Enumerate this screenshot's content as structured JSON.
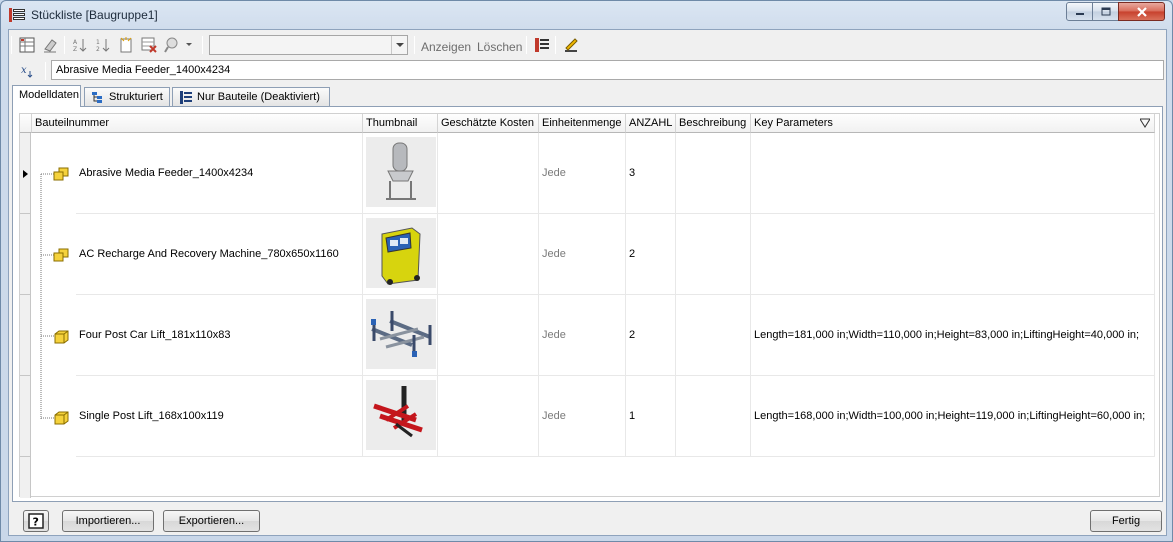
{
  "window": {
    "title": "Stückliste [Baugruppe1]"
  },
  "toolbar": {
    "combo_value": "",
    "show_label": "Anzeigen",
    "delete_label": "Löschen"
  },
  "formula": {
    "value": "Abrasive Media Feeder_1400x4234"
  },
  "tabs": [
    {
      "label": "Modelldaten"
    },
    {
      "label": "Strukturiert"
    },
    {
      "label": "Nur Bauteile (Deaktiviert)"
    }
  ],
  "table": {
    "columns": [
      "Bauteilnummer",
      "Thumbnail",
      "Geschätzte Kosten",
      "Einheitenmenge",
      "ANZAHL",
      "Beschreibung",
      "Key Parameters"
    ],
    "rows": [
      {
        "part": "Abrasive Media Feeder_1400x4234",
        "thumbnail": "media-feeder-thumbnail",
        "cost": "",
        "unit": "Jede",
        "qty": "3",
        "desc": "",
        "params": ""
      },
      {
        "part": "AC Recharge And Recovery Machine_780x650x1160",
        "thumbnail": "ac-machine-thumbnail",
        "cost": "",
        "unit": "Jede",
        "qty": "2",
        "desc": "",
        "params": ""
      },
      {
        "part": "Four Post Car Lift_181x110x83",
        "thumbnail": "four-post-lift-thumbnail",
        "cost": "",
        "unit": "Jede",
        "qty": "2",
        "desc": "",
        "params": "Length=181,000 in;Width=110,000 in;Height=83,000 in;LiftingHeight=40,000 in;"
      },
      {
        "part": "Single Post Lift_168x100x119",
        "thumbnail": "single-post-lift-thumbnail",
        "cost": "",
        "unit": "Jede",
        "qty": "1",
        "desc": "",
        "params": "Length=168,000 in;Width=100,000 in;Height=119,000 in;LiftingHeight=60,000 in;"
      }
    ]
  },
  "buttons": {
    "import_label": "Importieren...",
    "export_label": "Exportieren...",
    "done_label": "Fertig"
  },
  "colors": {
    "accent_title": "#c9d9ec",
    "close_red": "#c7402c",
    "assembly_yellow": "#f5d23c"
  }
}
